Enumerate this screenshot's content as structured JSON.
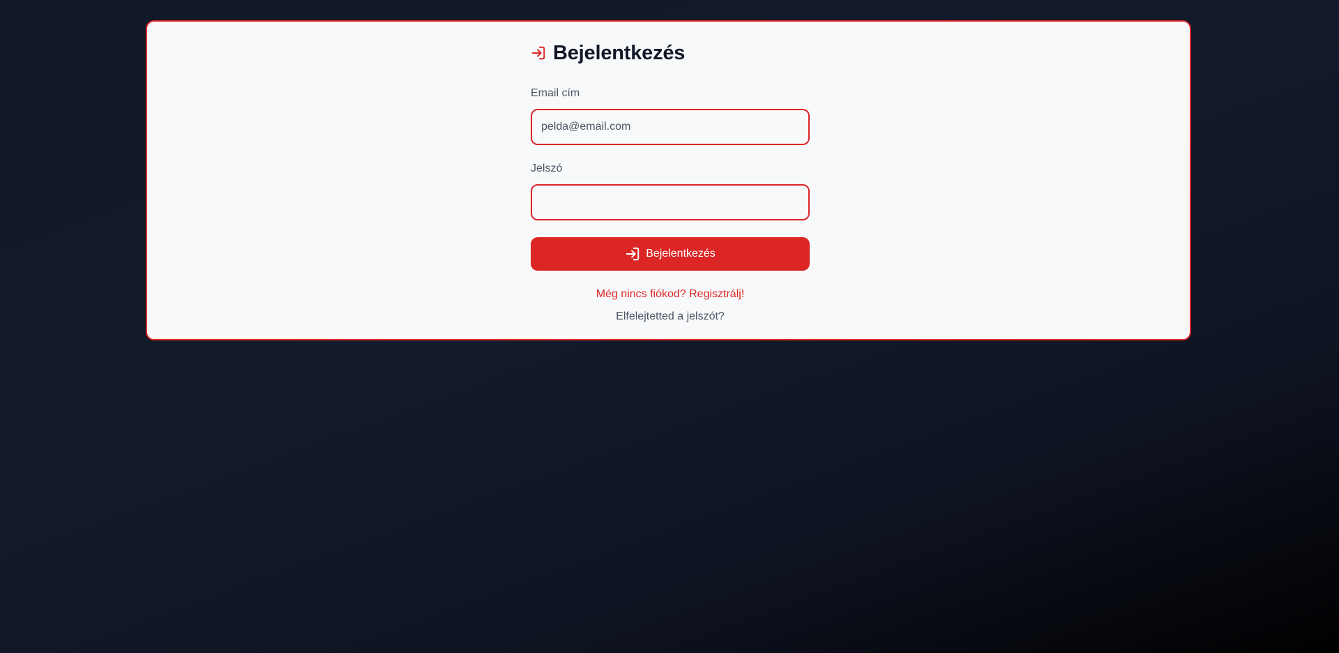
{
  "login": {
    "title": "Bejelentkezés",
    "email_label": "Email cím",
    "email_placeholder": "pelda@email.com",
    "email_value": "",
    "password_label": "Jelszó",
    "password_value": "",
    "submit_label": "Bejelentkezés",
    "register_link": "Még nincs fiókod? Regisztrálj!",
    "forgot_link": "Elfelejtetted a jelszót?"
  },
  "icons": {
    "title_icon": "login-icon",
    "button_icon": "login-icon"
  },
  "colors": {
    "accent": "#dc2626",
    "background": "#111827",
    "card": "#f8f9fb",
    "title": "#111827",
    "muted_text": "#4b5563"
  }
}
